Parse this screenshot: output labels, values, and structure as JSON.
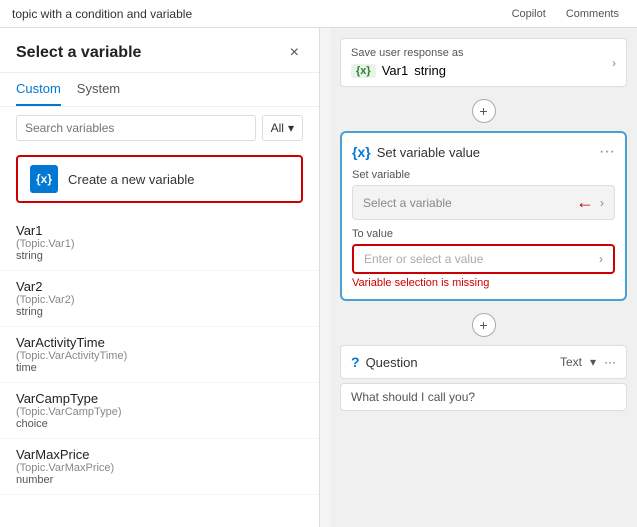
{
  "topBar": {
    "title": "topic with a condition and variable",
    "copilot": "Copilot",
    "comments": "Comments"
  },
  "leftPanel": {
    "title": "Select a variable",
    "closeIcon": "×",
    "tabs": [
      {
        "label": "Custom",
        "active": true
      },
      {
        "label": "System",
        "active": false
      }
    ],
    "search": {
      "placeholder": "Search variables",
      "filterLabel": "All",
      "filterIcon": "▾"
    },
    "createNew": {
      "iconLabel": "{x}",
      "text": "Create a new variable"
    },
    "variables": [
      {
        "name": "Var1",
        "topic": "(Topic.Var1)",
        "type": "string"
      },
      {
        "name": "Var2",
        "topic": "(Topic.Var2)",
        "type": "string"
      },
      {
        "name": "VarActivityTime",
        "topic": "(Topic.VarActivityTime)",
        "type": "time"
      },
      {
        "name": "VarCampType",
        "topic": "(Topic.VarCampType)",
        "type": "choice"
      },
      {
        "name": "VarMaxPrice",
        "topic": "(Topic.VarMaxPrice)",
        "type": "number"
      }
    ]
  },
  "rightPanel": {
    "saveResponse": {
      "label": "Save user response as",
      "varBadge": "{x}",
      "varName": "Var1",
      "varType": "string"
    },
    "setVarCard": {
      "icon": "{x}",
      "title": "Set variable value",
      "setVarLabel": "Set variable",
      "selectVarPlaceholder": "Select a variable",
      "toValueLabel": "To value",
      "toValuePlaceholder": "Enter or select a value",
      "errorMsg": "Variable selection is missing"
    },
    "questionCard": {
      "icon": "?",
      "title": "Question",
      "type": "Text",
      "chevron": "▾"
    }
  }
}
